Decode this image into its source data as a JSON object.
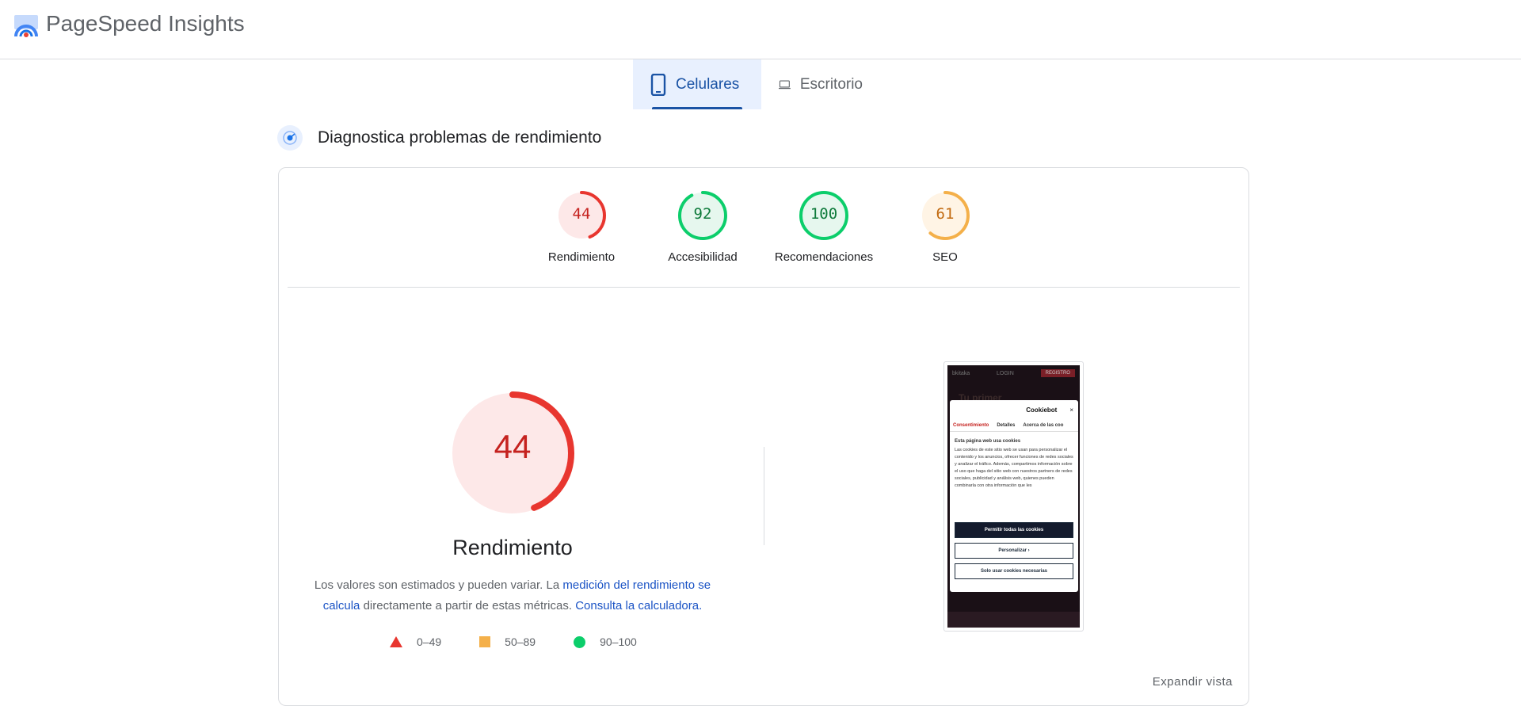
{
  "header": {
    "title": "PageSpeed Insights",
    "logo_icon": "pagespeed-logo-icon"
  },
  "tabs": [
    {
      "label": "Celulares",
      "icon": "smartphone-icon",
      "active": true
    },
    {
      "label": "Escritorio",
      "icon": "laptop-icon",
      "active": false
    }
  ],
  "diagnostics": {
    "title": "Diagnostica problemas de rendimiento",
    "icon": "diagnose-icon"
  },
  "scores": [
    {
      "value": "44",
      "label": "Rendimiento",
      "score": 44,
      "color": "#e8362f",
      "bg": "#fde8e8",
      "text_color": "#c5221f"
    },
    {
      "value": "92",
      "label": "Accesibilidad",
      "score": 92,
      "color": "#0cce6b",
      "bg": "#e6f7ee",
      "text_color": "#0d7a3a"
    },
    {
      "value": "100",
      "label": "Recomendaciones",
      "score": 100,
      "color": "#0cce6b",
      "bg": "#e6f7ee",
      "text_color": "#0d7a3a"
    },
    {
      "value": "61",
      "label": "SEO",
      "score": 61,
      "color": "#f4b04a",
      "bg": "#fff4e5",
      "text_color": "#c26a10"
    }
  ],
  "performance": {
    "score": "44",
    "score_value": 44,
    "label": "Rendimiento",
    "desc_1": "Los valores son estimados y pueden variar. La ",
    "desc_link_1": "medición del rendimiento se calcula",
    "desc_2": " directamente a partir de estas métricas. ",
    "desc_link_2": "Consulta la calculadora.",
    "legend": [
      {
        "range": "0–49",
        "shape": "triangle",
        "color": "#e8362f"
      },
      {
        "range": "50–89",
        "shape": "square",
        "color": "#f4b04a"
      },
      {
        "range": "90–100",
        "shape": "circle",
        "color": "#0cce6b"
      }
    ]
  },
  "screenshot": {
    "site_logo": "bkitaka",
    "login": "LOGIN",
    "register": "REGISTRO",
    "hero": "Tu primer",
    "dialog_brand": "Cookiebot",
    "close": "×",
    "tabs": [
      "Consentimiento",
      "Detalles",
      "Acerca de las coo"
    ],
    "heading": "Esta página web usa cookies",
    "body": "Las cookies de este sitio web se usan para personalizar el contenido y los anuncios, ofrecer funciones de redes sociales y analizar el tráfico. Además, compartimos información sobre el uso que haga del sitio web con nuestros partners de redes sociales, publicidad y análisis web, quienes pueden combinarla con otra información que les",
    "btn_allow": "Permitir todas las cookies",
    "btn_customize": "Personalizar  ›",
    "btn_necessary": "Solo usar cookies necesarias"
  },
  "expand": "Expandir vista"
}
